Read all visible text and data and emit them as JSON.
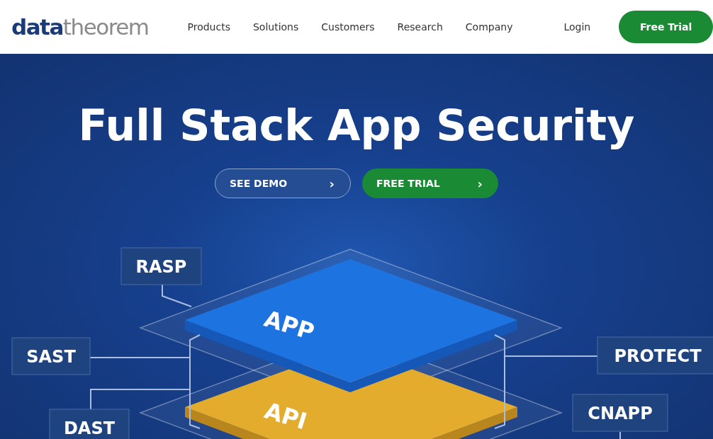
{
  "header": {
    "logo": {
      "part_1": "data",
      "part_2": "theorem"
    },
    "nav": [
      {
        "label": "Products"
      },
      {
        "label": "Solutions"
      },
      {
        "label": "Customers"
      },
      {
        "label": "Research"
      },
      {
        "label": "Company"
      }
    ],
    "login": "Login",
    "cta": "Free Trial"
  },
  "hero": {
    "title": "Full Stack App Security",
    "buttons": [
      {
        "label": "SEE DEMO",
        "kind": "outline",
        "icon": "›"
      },
      {
        "label": "FREE TRIAL",
        "kind": "filled",
        "icon": "›"
      }
    ],
    "layers": [
      {
        "label": "APP",
        "kind": "app"
      },
      {
        "label": "API",
        "kind": "api"
      }
    ],
    "tags": [
      {
        "label": "RASP"
      },
      {
        "label": "SAST"
      },
      {
        "label": "DAST"
      },
      {
        "label": "PROTECT"
      },
      {
        "label": "CNAPP"
      }
    ]
  }
}
